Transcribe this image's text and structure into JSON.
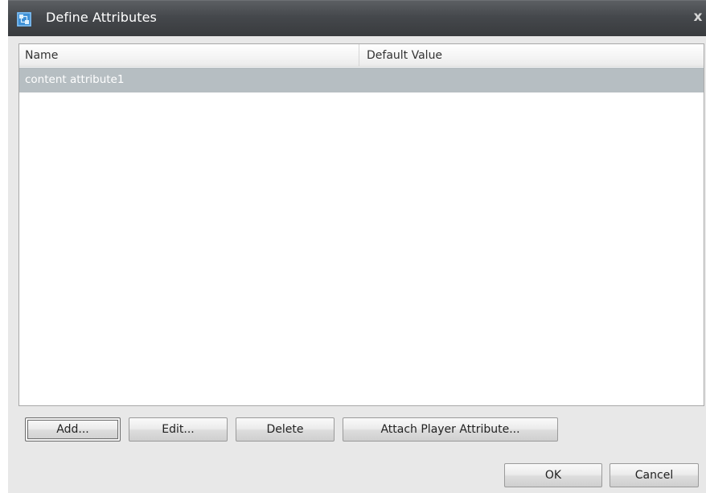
{
  "window": {
    "title": "Define Attributes",
    "close_glyph": "x",
    "icon": "attributes-icon"
  },
  "table": {
    "columns": [
      "Name",
      "Default Value"
    ],
    "rows": [
      {
        "name": "content attribute1",
        "default_value": "",
        "selected": true
      }
    ]
  },
  "actions": {
    "add": "Add...",
    "edit": "Edit...",
    "delete": "Delete",
    "attach": "Attach Player Attribute..."
  },
  "footer": {
    "ok": "OK",
    "cancel": "Cancel"
  },
  "colors": {
    "titlebar": "#45484c",
    "selection": "#b6bec2",
    "dialog_bg": "#e8e8e8",
    "icon_blue": "#3c8fd6"
  }
}
